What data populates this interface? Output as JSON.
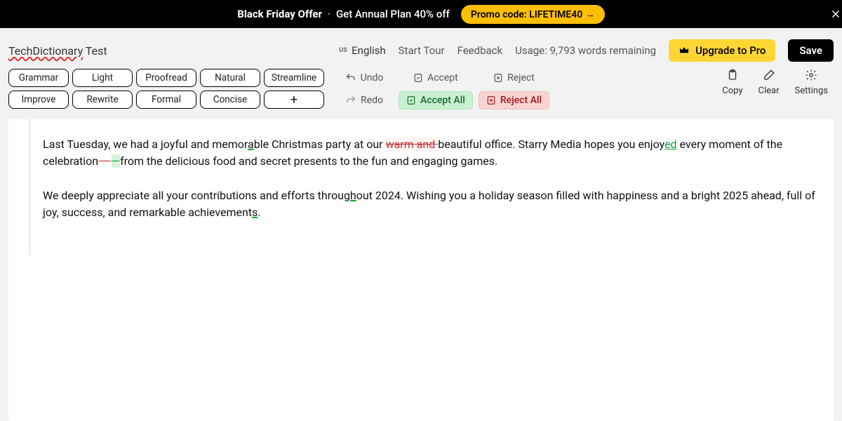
{
  "promo": {
    "offer": "Black Friday Offer",
    "sub": "Get Annual Plan 40% off",
    "code": "Promo code: LIFETIME40 →"
  },
  "header": {
    "title_part1": "TechDictionary",
    "title_part2": " Test",
    "lang_flag": "us",
    "lang_name": "English",
    "start_tour": "Start Tour",
    "feedback": "Feedback",
    "usage": "Usage: 9,793 words remaining",
    "upgrade": "Upgrade to Pro",
    "save": "Save"
  },
  "modes": {
    "row1": [
      "Grammar",
      "Light",
      "Proofread",
      "Natural",
      "Streamline"
    ],
    "row2": [
      "Improve",
      "Rewrite",
      "Formal",
      "Concise",
      "+"
    ]
  },
  "actions": {
    "undo": "Undo",
    "redo": "Redo",
    "accept": "Accept",
    "accept_all": "Accept All",
    "reject": "Reject",
    "reject_all": "Reject All"
  },
  "tools": {
    "copy": "Copy",
    "clear": "Clear",
    "settings": "Settings"
  },
  "content": {
    "p1_a": "Last Tuesday, we had a joyful and memor",
    "p1_a_mark": "a",
    "p1_b": "ble Christmas party at our ",
    "p1_del": "warm and ",
    "p1_c": "beautiful office. Starry Media hopes you enjoy",
    "p1_ins": "ed",
    "p1_d": " every moment of the celebration",
    "p1_dash_del": " – ",
    "p1_dash_ins": "—",
    "p1_e": "from the delicious food and secret presents to the fun and engaging games.",
    "p2_a": "We deeply appreciate all your contributions and efforts throug",
    "p2_mark1": "h",
    "p2_b": "out 2024. Wishing you a holiday season filled with happiness and a bright 2025 ahead, full of joy, success, and remarkable achievement",
    "p2_mark2": "s",
    "p2_c": "."
  }
}
